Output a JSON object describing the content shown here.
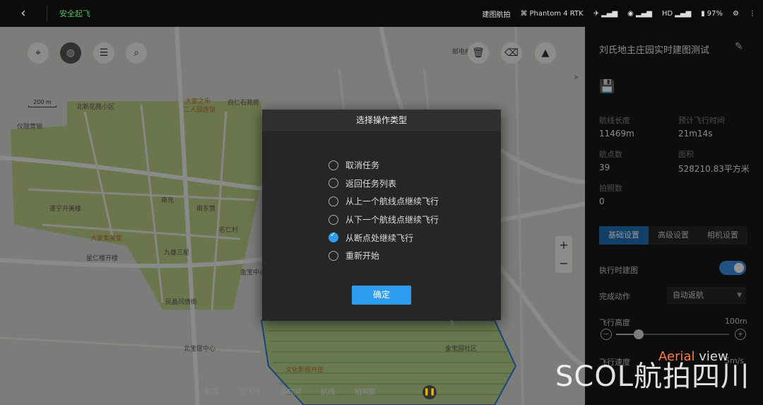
{
  "topbar": {
    "back_icon": "chevron-left-icon",
    "status": "安全起飞",
    "mode": "建图航拍",
    "aircraft": "Phantom 4 RTK",
    "hd_label": "HD",
    "battery": "97%"
  },
  "map": {
    "scale_label": "200 m",
    "zoom_in": "+",
    "zoom_out": "−",
    "collapse": "»",
    "labels": {
      "l1": "邮电楼",
      "l2": "北新花苑小区",
      "l3": "仪陇营销",
      "l4": "二人园连锁",
      "l5": "自仁石苑房",
      "l6": "大家之乐",
      "l7": "南充",
      "l8": "南东营",
      "l9": "遂宁开美楼",
      "l10": "大家卖美家",
      "l11": "星仁楼开楼",
      "l12": "九雄三星",
      "l13": "民晶风情街",
      "l14": "名仁村",
      "l15": "北宝居中心",
      "l16": "文化影视开庄",
      "l17": "金宝园社区",
      "l18": "金宝中心"
    }
  },
  "dialog": {
    "title": "选择操作类型",
    "options": [
      {
        "label": "取消任务",
        "checked": false
      },
      {
        "label": "返回任务列表",
        "checked": false
      },
      {
        "label": "从上一个航线点继续飞行",
        "checked": false
      },
      {
        "label": "从下一个航线点继续飞行",
        "checked": false
      },
      {
        "label": "从断点处继续飞行",
        "checked": true
      },
      {
        "label": "重新开始",
        "checked": false
      }
    ],
    "confirm": "确定"
  },
  "panel": {
    "title": "刘氏地主庄园实时建图测试",
    "stats": {
      "length_label": "航线长度",
      "length_value": "11469m",
      "time_label": "预计飞行时间",
      "time_value": "21m14s",
      "waypoints_label": "航点数",
      "waypoints_value": "39",
      "area_label": "面积",
      "area_value": "528210.83平方米",
      "photos_label": "拍照数",
      "photos_value": "0"
    },
    "tabs": [
      "基础设置",
      "高级设置",
      "相机设置"
    ],
    "realtime_label": "执行时建图",
    "finish_label": "完成动作",
    "finish_value": "自动返航",
    "altitude_label": "飞行高度",
    "altitude_value": "100m",
    "altitude_fraction": 0.2,
    "speed_label": "飞行速度",
    "speed_value": "5m/s"
  },
  "bottom": {
    "items": [
      "航高",
      "总飞行",
      "总时间",
      "航线",
      "拍照数"
    ]
  },
  "watermark": {
    "main": "SCOL航拍四川",
    "aerial": "Aerial",
    "view": "view"
  }
}
